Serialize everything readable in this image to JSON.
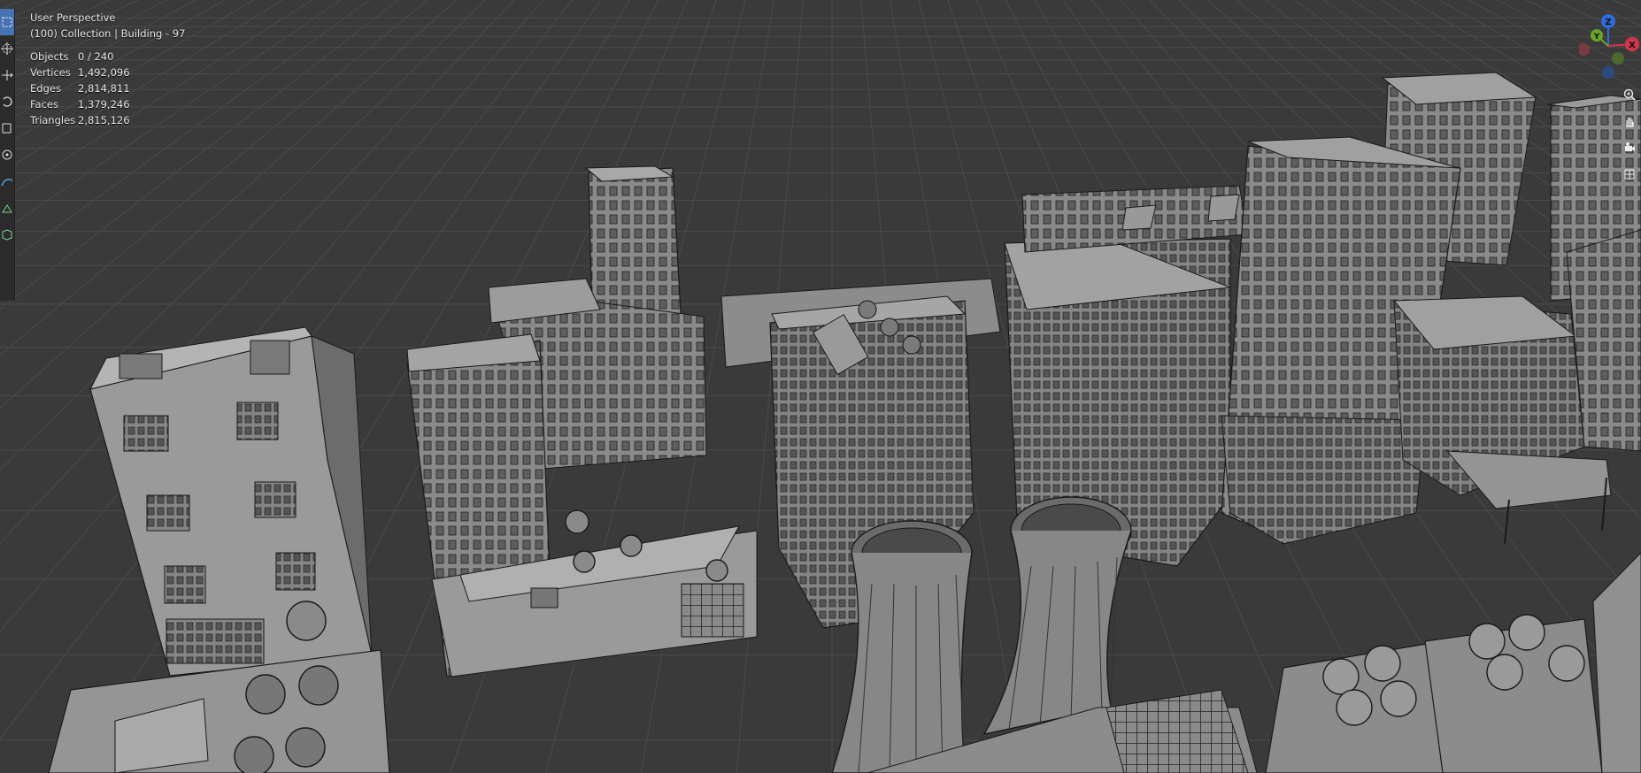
{
  "viewport": {
    "mode": "User Perspective",
    "collection": "(100) Collection | Building - 97"
  },
  "stats": [
    {
      "label": "Objects",
      "value": "0 / 240"
    },
    {
      "label": "Vertices",
      "value": "1,492,096"
    },
    {
      "label": "Edges",
      "value": "2,814,811"
    },
    {
      "label": "Faces",
      "value": "1,379,246"
    },
    {
      "label": "Triangles",
      "value": "2,815,126"
    }
  ],
  "toolbar": {
    "tools": [
      {
        "name": "select-box-icon",
        "active": true
      },
      {
        "name": "cursor-icon",
        "active": false
      },
      {
        "name": "move-icon",
        "active": false
      },
      {
        "name": "rotate-icon",
        "active": false
      },
      {
        "name": "scale-icon",
        "active": false
      },
      {
        "name": "transform-icon",
        "active": false
      },
      {
        "name": "annotate-icon",
        "active": false
      },
      {
        "name": "measure-icon",
        "active": false
      },
      {
        "name": "add-cube-icon",
        "active": false
      }
    ]
  },
  "gizmo": {
    "axes": [
      {
        "label": "Z",
        "color": "#2f6bd8"
      },
      {
        "label": "Y",
        "color": "#6aa52a"
      },
      {
        "label": "X",
        "color": "#d5354a"
      }
    ]
  },
  "navigation": [
    {
      "name": "zoom-icon"
    },
    {
      "name": "pan-hand-icon"
    },
    {
      "name": "camera-icon"
    },
    {
      "name": "grid-view-icon"
    }
  ],
  "colors": {
    "viewport_bg": "#3a3a3a",
    "grid": "#4a4a4a",
    "building_fill": "#8e8e8e",
    "building_edge": "#1a1a1a",
    "active_tool": "#4772b3"
  }
}
